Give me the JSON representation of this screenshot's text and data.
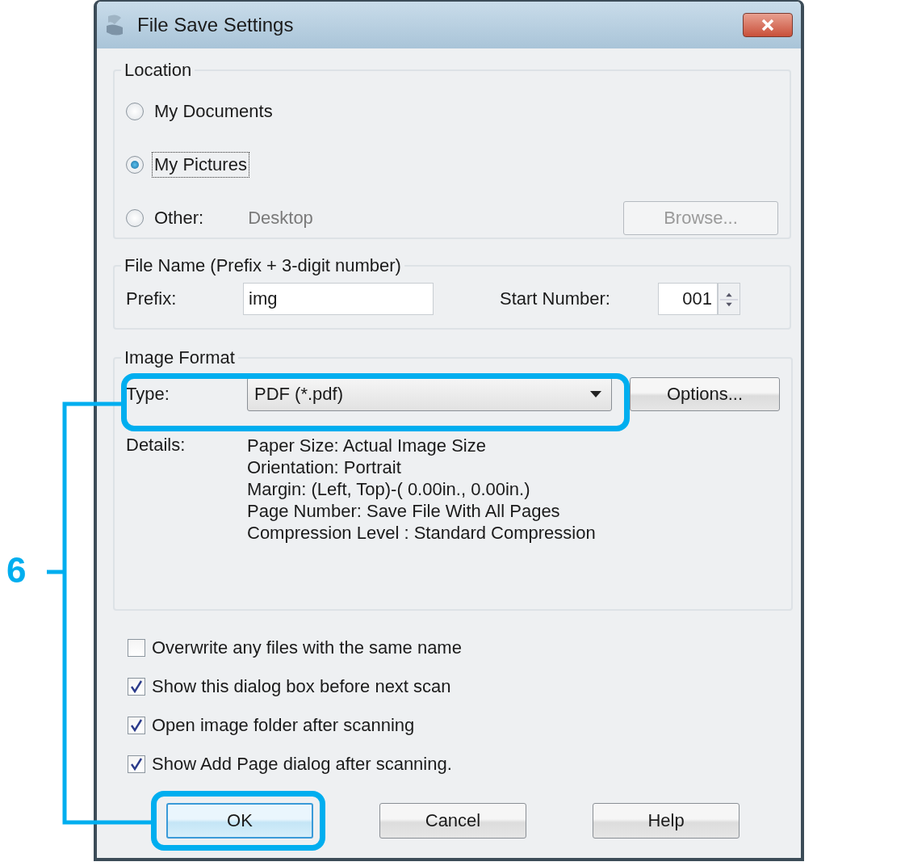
{
  "window": {
    "title": "File Save Settings"
  },
  "location": {
    "label": "Location",
    "options": [
      {
        "label": "My Documents",
        "selected": false,
        "focused": false
      },
      {
        "label": "My Pictures",
        "selected": true,
        "focused": true
      },
      {
        "label": "Other:",
        "selected": false,
        "focused": false,
        "value": "Desktop"
      }
    ],
    "browse_button": {
      "label": "Browse...",
      "disabled": true
    }
  },
  "file_name": {
    "label": "File Name (Prefix + 3-digit number)",
    "prefix_label": "Prefix:",
    "prefix": "img",
    "start_number_label": "Start Number:",
    "start_number": "001"
  },
  "image_format": {
    "label": "Image Format",
    "type_label": "Type:",
    "type": "PDF (*.pdf)",
    "options_button": "Options...",
    "details_label": "Details:",
    "details": [
      "Paper Size: Actual Image Size",
      "Orientation: Portrait",
      "Margin: (Left, Top)-( 0.00in., 0.00in.)",
      "Page Number: Save File With All Pages",
      "Compression Level : Standard Compression"
    ]
  },
  "checkboxes": [
    {
      "label": "Overwrite any files with the same name",
      "checked": false
    },
    {
      "label": "Show this dialog box before next scan",
      "checked": true
    },
    {
      "label": "Open image folder after scanning",
      "checked": true
    },
    {
      "label": "Show Add Page dialog after scanning.",
      "checked": true
    }
  ],
  "buttons": [
    {
      "label": "OK",
      "default": true
    },
    {
      "label": "Cancel",
      "default": false
    },
    {
      "label": "Help",
      "default": false
    }
  ],
  "annotation": {
    "step": "6"
  }
}
